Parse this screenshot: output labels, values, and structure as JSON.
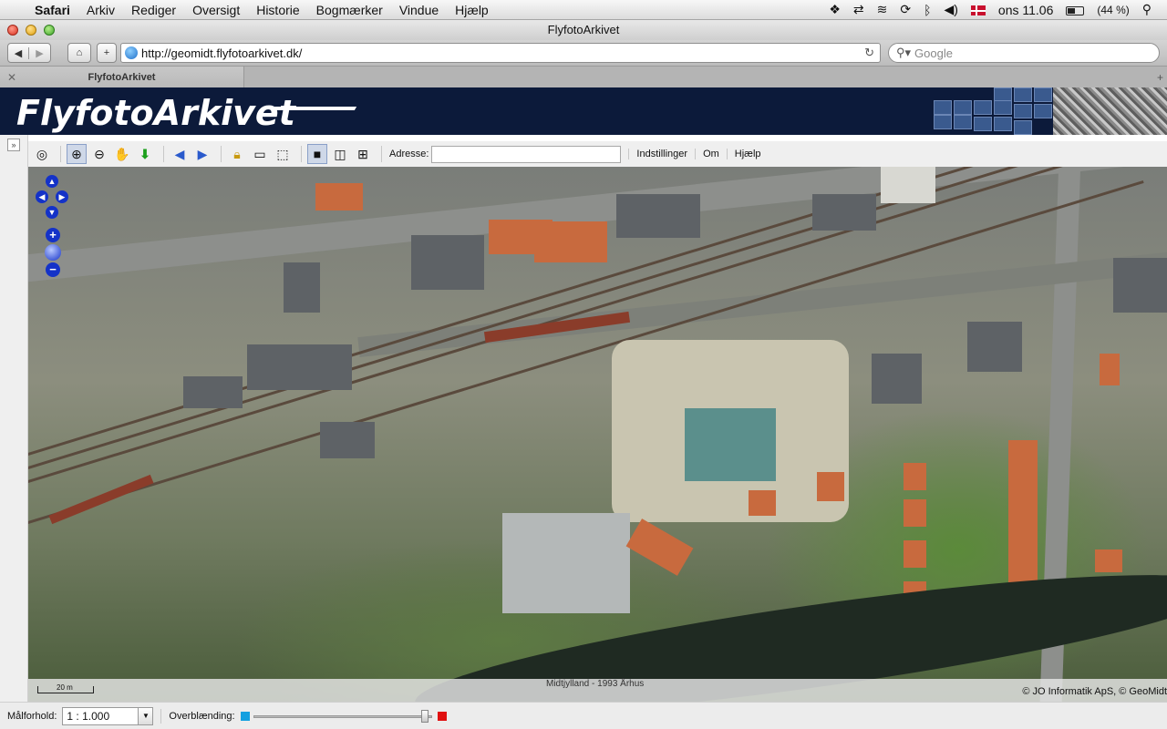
{
  "menubar": {
    "app": "Safari",
    "items": [
      "Arkiv",
      "Rediger",
      "Oversigt",
      "Historie",
      "Bogmærker",
      "Vindue",
      "Hjælp"
    ],
    "clock": "ons 11.06",
    "battery": "(44 %)"
  },
  "window": {
    "title": "FlyfotoArkivet"
  },
  "browser": {
    "url": "http://geomidt.flyfotoarkivet.dk/",
    "search_placeholder": "Google",
    "tab_label": "FlyfotoArkivet"
  },
  "banner": {
    "logo_text": "FlyfotoArkivet"
  },
  "map_toolbar": {
    "address_label": "Adresse:",
    "address_value": "",
    "links": [
      "Indstillinger",
      "Om",
      "Hjælp"
    ]
  },
  "map": {
    "scale_label": "20 m",
    "source": "Midtjylland - 1993 Århus",
    "copyright": "© JO Informatik ApS, © GeoMidt"
  },
  "bottom": {
    "scale_label": "Målforhold:",
    "scale_value": "1 : 1.000",
    "overlay_label": "Overblænding:",
    "overlay_level": 0.96
  },
  "colors": {
    "banner_bg": "#0c1a3a",
    "nav_blue": "#1432c8",
    "slider_left": "#14a0e0",
    "slider_right": "#e01010"
  }
}
